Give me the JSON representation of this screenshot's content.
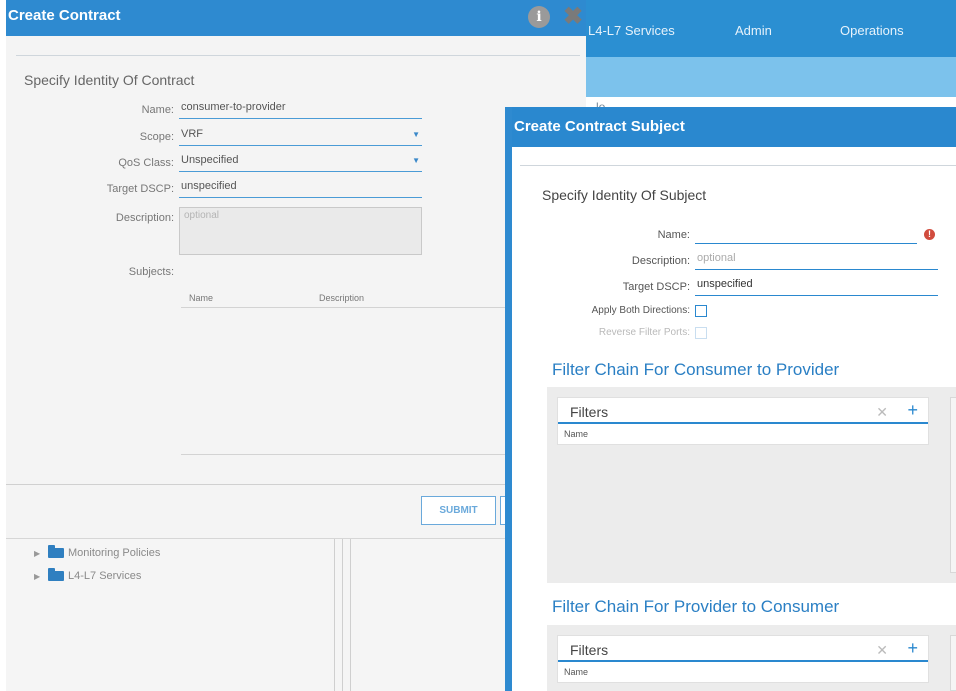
{
  "app_nav": {
    "items": [
      "L4-L7 Services",
      "Admin",
      "Operations"
    ],
    "fragment": "lo"
  },
  "create_contract": {
    "title": "Create Contract",
    "section_title": "Specify Identity Of Contract",
    "fields": {
      "name_label": "Name:",
      "name_value": "consumer-to-provider",
      "scope_label": "Scope:",
      "scope_value": "VRF",
      "qos_label": "QoS Class:",
      "qos_value": "Unspecified",
      "dscp_label": "Target DSCP:",
      "dscp_value": "unspecified",
      "description_label": "Description:",
      "description_placeholder": "optional"
    },
    "subjects_label": "Subjects:",
    "subjects_columns": [
      "Name",
      "Description"
    ],
    "submit_label": "SUBMIT"
  },
  "tree": {
    "items": [
      "Monitoring Policies",
      "L4-L7 Services"
    ]
  },
  "create_contract_subject": {
    "title": "Create Contract Subject",
    "section_title": "Specify Identity Of Subject",
    "fields": {
      "name_label": "Name:",
      "name_value": "",
      "description_label": "Description:",
      "description_placeholder": "optional",
      "dscp_label": "Target DSCP:",
      "dscp_value": "unspecified",
      "apply_both_label": "Apply Both Directions:",
      "reverse_ports_label": "Reverse Filter Ports:"
    },
    "chain_consumer": {
      "title": "Filter Chain For Consumer to Provider",
      "filters_title": "Filters",
      "column": "Name"
    },
    "chain_provider": {
      "title": "Filter Chain For Provider to Consumer",
      "filters_title": "Filters",
      "column": "Name"
    }
  }
}
